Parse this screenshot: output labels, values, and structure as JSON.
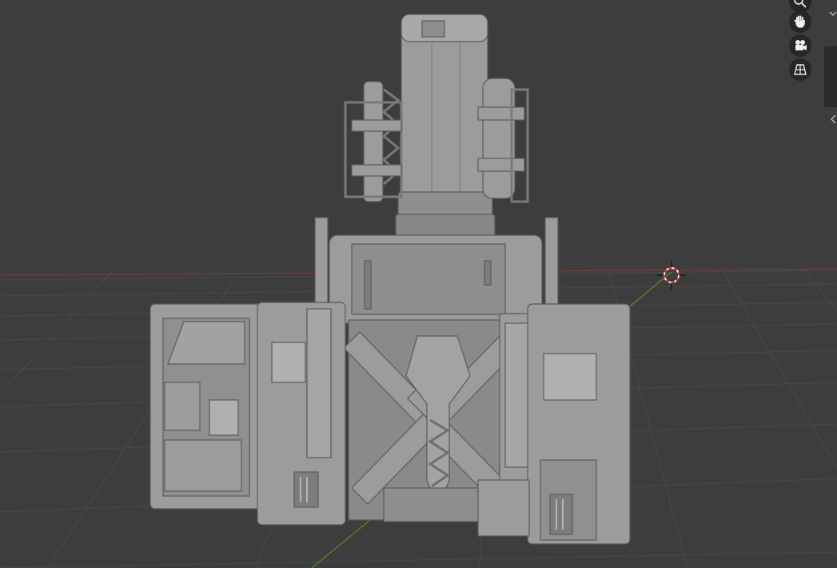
{
  "app": "Blender",
  "viewport": {
    "background": "#3d3d3d",
    "grid_color": "#4a4a4a",
    "x_axis_color": "#8a3a3a",
    "y_axis_color": "#5c8a2a",
    "object_color": "#9c9c9c"
  },
  "navigation_gizmo": {
    "buttons": [
      {
        "icon": "zoom-icon"
      },
      {
        "icon": "hand-pan-icon"
      },
      {
        "icon": "camera-icon"
      },
      {
        "icon": "perspective-grid-icon"
      }
    ]
  },
  "cursor_3d": {
    "icon": "3d-cursor-icon"
  }
}
